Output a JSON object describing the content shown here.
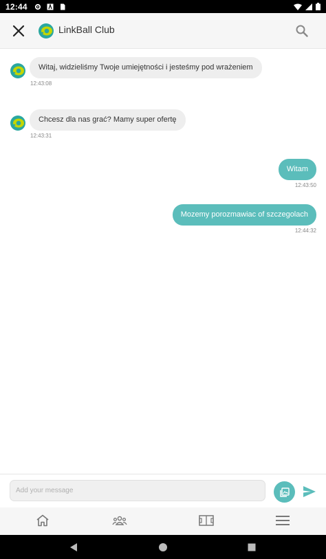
{
  "status_bar": {
    "time": "12:44",
    "icons": [
      "settings-icon",
      "font-icon",
      "sim-icon",
      "wifi-icon",
      "signal-icon",
      "battery-icon"
    ]
  },
  "header": {
    "title": "LinkBall Club",
    "logo_icon": "linkball-logo",
    "close_icon": "close-icon",
    "search_icon": "search-icon"
  },
  "messages": [
    {
      "direction": "incoming",
      "text": "Witaj, widzieliśmy Twoje umiejętności i jesteśmy pod wrażeniem",
      "time": "12:43:08"
    },
    {
      "direction": "incoming",
      "text": "Chcesz dla nas grać? Mamy super ofertę",
      "time": "12:43:31"
    },
    {
      "direction": "outgoing",
      "text": "Witam",
      "time": "12:43:50"
    },
    {
      "direction": "outgoing",
      "text": "Mozemy porozmawiac of szczegolach",
      "time": "12:44:32"
    }
  ],
  "composer": {
    "placeholder": "Add your message",
    "value": "",
    "media_icon": "image-icon",
    "send_icon": "send-icon"
  },
  "bottom_nav": [
    "home-icon",
    "team-icon",
    "field-icon",
    "menu-icon"
  ],
  "android_nav": [
    "back-icon",
    "home-circle-icon",
    "recents-icon"
  ],
  "colors": {
    "accent": "#5bbdbb",
    "incoming_bubble": "#eeeeee",
    "header_bg": "#f6f6f6",
    "logo_ring": "#2aa7a0",
    "logo_ball": "#c4d600"
  }
}
